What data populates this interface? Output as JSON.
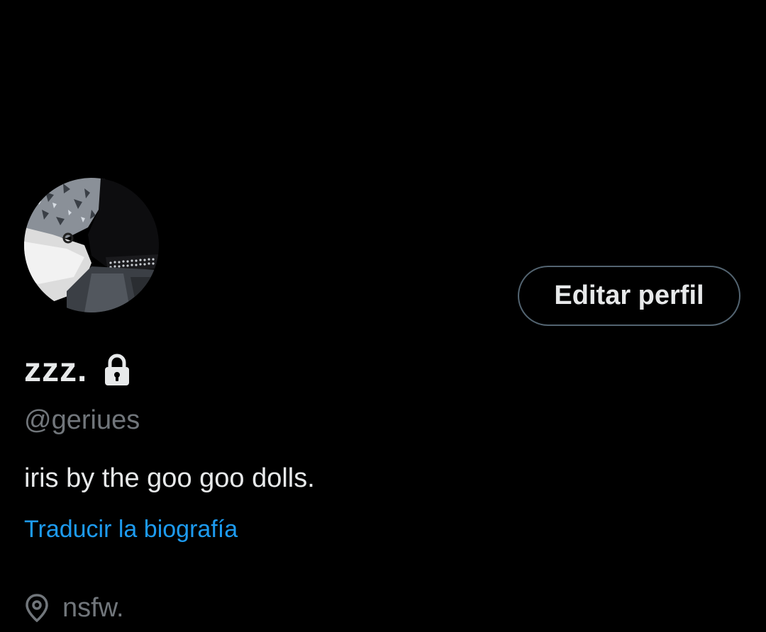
{
  "profile": {
    "display_name": "zzz.",
    "handle": "@geriues",
    "bio": "iris by the goo goo dolls.",
    "translate_label": "Traducir la biografía",
    "location": "nsfw.",
    "edit_button_label": "Editar perfil",
    "is_protected": true
  },
  "icons": {
    "lock": "lock-icon",
    "location": "location-pin-icon"
  },
  "colors": {
    "background": "#000000",
    "primary_text": "#e7e9ea",
    "secondary_text": "#71767b",
    "link": "#1d9bf0",
    "button_border": "#536471"
  }
}
